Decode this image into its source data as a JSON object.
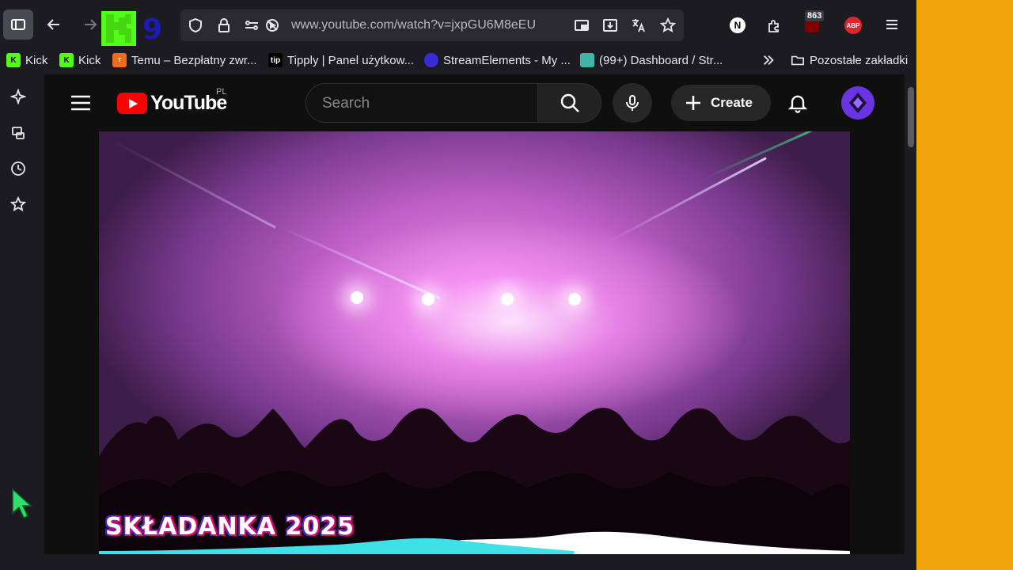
{
  "browser": {
    "url": "www.youtube.com/watch?v=jxpGU6M8eEU",
    "extension_badge": "863",
    "bookmarks": [
      {
        "label": "Kick",
        "icon": "kick-icon"
      },
      {
        "label": "Kick",
        "icon": "kick-icon"
      },
      {
        "label": "Temu – Bezpłatny zwr...",
        "icon": "temu-icon"
      },
      {
        "label": "Tipply | Panel użytkow...",
        "icon": "tipply-icon"
      },
      {
        "label": "StreamElements - My ...",
        "icon": "streamelements-icon"
      },
      {
        "label": "(99+) Dashboard / Str...",
        "icon": "discord-icon"
      }
    ],
    "other_bookmarks": "Pozostałe zakładki"
  },
  "overlay_logo": {
    "digit": "9"
  },
  "youtube": {
    "logo_text": "YouTube",
    "region": "PL",
    "search_placeholder": "Search",
    "create_label": "Create"
  },
  "video": {
    "title_overlay": "SKŁADANKA 2025"
  },
  "colors": {
    "youtube_red": "#ff0000",
    "side_pane": "#f2a60d",
    "kick_green": "#53fc18"
  }
}
